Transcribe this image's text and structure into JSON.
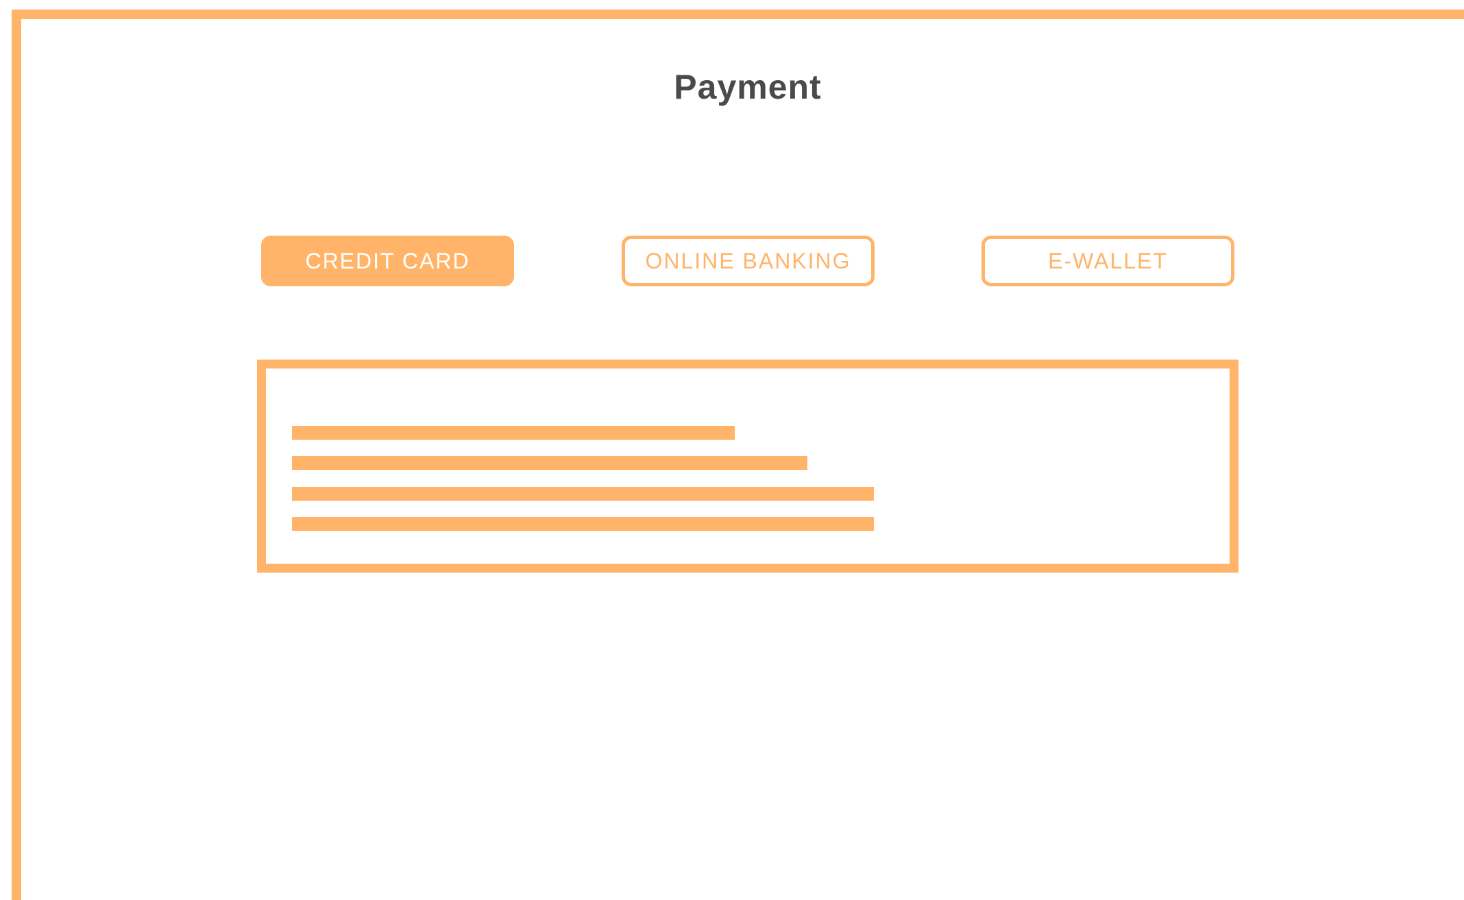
{
  "page": {
    "title": "Payment"
  },
  "tabs": [
    {
      "label": "CREDIT CARD",
      "selected": true
    },
    {
      "label": "ONLINE BANKING",
      "selected": false
    },
    {
      "label": "E-WALLET",
      "selected": false
    }
  ],
  "colors": {
    "accent": "#FFB469",
    "title_text": "#4a4a4a",
    "background": "#ffffff"
  },
  "panel": {
    "content": "placeholder-lines"
  }
}
